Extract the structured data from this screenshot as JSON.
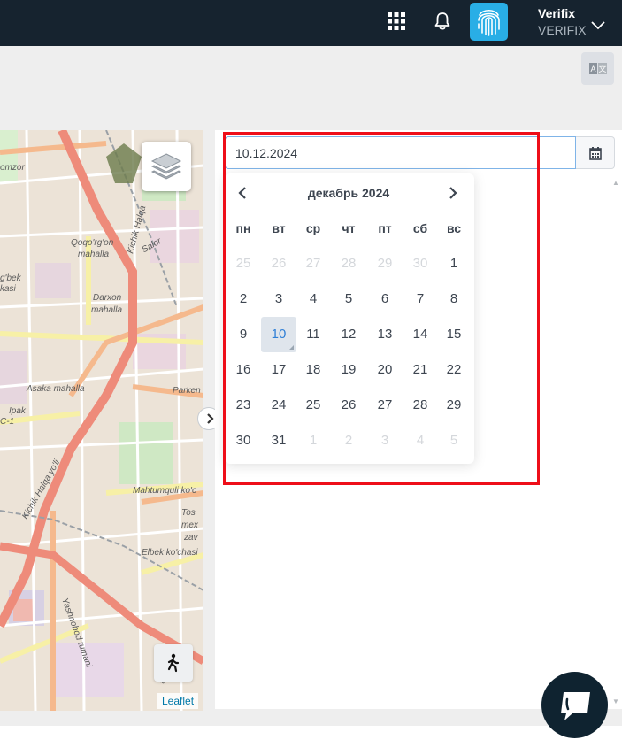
{
  "header": {
    "user_name": "Verifix",
    "company": "VERIFIX",
    "icons": [
      "apps-grid-icon",
      "bell-icon",
      "fingerprint-icon",
      "chevron-down-icon"
    ]
  },
  "toolbar": {
    "icons": [
      "translate-icon"
    ]
  },
  "map": {
    "attribution": "Leaflet",
    "labels": [
      "Qoqo'rg'on",
      "mahalla",
      "Darxon",
      "mahalla",
      "Asaka mahalla",
      "Parken",
      "Mahtumquli ko'c",
      "Elbek ko'chasi",
      "Tos",
      "mex",
      "zav",
      "Ipak",
      "Kichik Halqa yo'li",
      "Yashnobod tumani",
      "Qorasuv",
      "Salor",
      "omzor",
      "g'bek",
      "kasi",
      "C-1"
    ],
    "icons": [
      "layers-icon",
      "pedestrian-icon",
      "chevron-right-icon"
    ]
  },
  "filter": {
    "date_value": "10.12.2024",
    "icons": [
      "calendar-icon"
    ]
  },
  "datepicker": {
    "title": "декабрь 2024",
    "weekdays": [
      "пн",
      "вт",
      "ср",
      "чт",
      "пт",
      "сб",
      "вс"
    ],
    "weeks": [
      [
        "25",
        "26",
        "27",
        "28",
        "29",
        "30",
        "1"
      ],
      [
        "2",
        "3",
        "4",
        "5",
        "6",
        "7",
        "8"
      ],
      [
        "9",
        "10",
        "11",
        "12",
        "13",
        "14",
        "15"
      ],
      [
        "16",
        "17",
        "18",
        "19",
        "20",
        "21",
        "22"
      ],
      [
        "23",
        "24",
        "25",
        "26",
        "27",
        "28",
        "29"
      ],
      [
        "30",
        "31",
        "1",
        "2",
        "3",
        "4",
        "5"
      ]
    ],
    "muted": [
      [
        true,
        true,
        true,
        true,
        true,
        true,
        false
      ],
      [
        false,
        false,
        false,
        false,
        false,
        false,
        false
      ],
      [
        false,
        false,
        false,
        false,
        false,
        false,
        false
      ],
      [
        false,
        false,
        false,
        false,
        false,
        false,
        false
      ],
      [
        false,
        false,
        false,
        false,
        false,
        false,
        false
      ],
      [
        false,
        false,
        true,
        true,
        true,
        true,
        true
      ]
    ],
    "selected": "10",
    "icons": [
      "chevron-left-icon",
      "chevron-right-icon"
    ]
  },
  "chat": {
    "icons": [
      "chat-icon"
    ]
  },
  "colors": {
    "topbar": "#16232f",
    "accent": "#29aee6",
    "highlight": "#ee0e19",
    "selected_day": "#2f7fd6"
  }
}
